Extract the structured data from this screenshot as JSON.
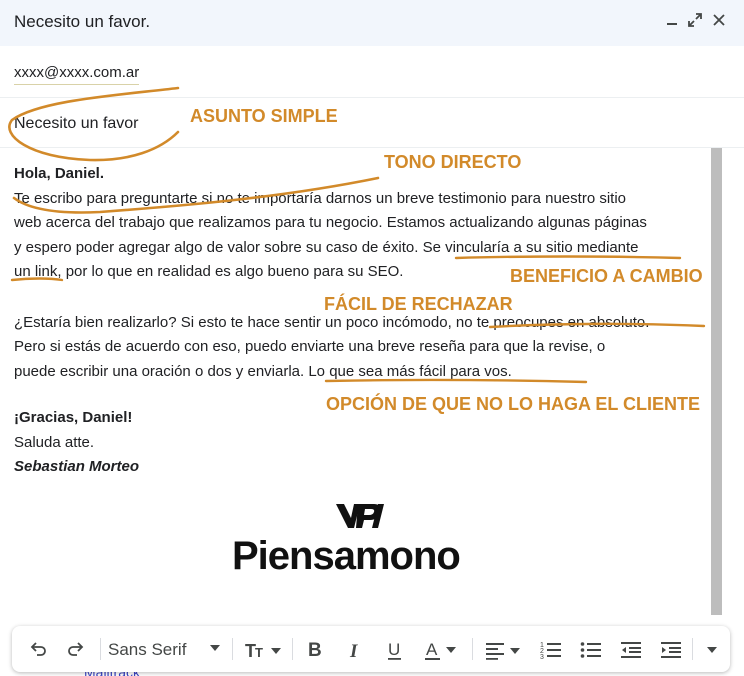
{
  "window": {
    "title": "Necesito un favor.",
    "icons": [
      "minimize-icon",
      "expand-icon",
      "close-icon"
    ]
  },
  "compose": {
    "to": "xxxx@xxxx.com.ar",
    "subject": "Necesito un favor",
    "body": {
      "greeting": "Hola, Daniel.",
      "p1_line1": "Te escribo para preguntarte si no te importaría darnos un breve testimonio para nuestro sitio",
      "p1_line2": "web acerca del trabajo que realizamos para tu negocio. Estamos actualizando algunas páginas",
      "p1_line3": "y espero poder agregar algo de valor sobre su caso de éxito. Se vincularía a su sitio mediante",
      "p1_line4": "un link, por lo que en realidad es algo bueno para su SEO.",
      "p2_line1": "¿Estaría bien realizarlo? Si esto te hace sentir un poco incómodo, no te preocupes en absoluto.",
      "p2_line2": "Pero si estás de acuerdo con eso, puedo enviarte una breve reseña para que la revise, o",
      "p2_line3": "puede escribir una oración o dos y enviarla. Lo que sea más fácil para vos.",
      "thanks": "¡Gracias, Daniel!",
      "closing": "Saluda atte.",
      "signature": "Sebastian Morteo"
    },
    "logo": {
      "text": "Piensamono",
      "mark_icon": "piensamono-logo-icon"
    }
  },
  "annotations": {
    "asunto": "ASUNTO SIMPLE",
    "tono": "TONO DIRECTO",
    "beneficio": "BENEFICIO A CAMBIO",
    "facil": "FÁCIL DE RECHAZAR",
    "opcion": "OPCIÓN DE QUE NO LO HAGA EL CLIENTE",
    "color": "#d28a2a"
  },
  "toolbar": {
    "font_family": "Sans Serif",
    "buttons": [
      "undo-icon",
      "redo-icon",
      "font-size-icon",
      "bold-icon",
      "italic-icon",
      "underline-icon",
      "text-color-icon",
      "align-icon",
      "numbered-list-icon",
      "bulleted-list-icon",
      "indent-less-icon",
      "indent-more-icon",
      "more-options-icon"
    ]
  },
  "behind_text": "Mailtrack"
}
